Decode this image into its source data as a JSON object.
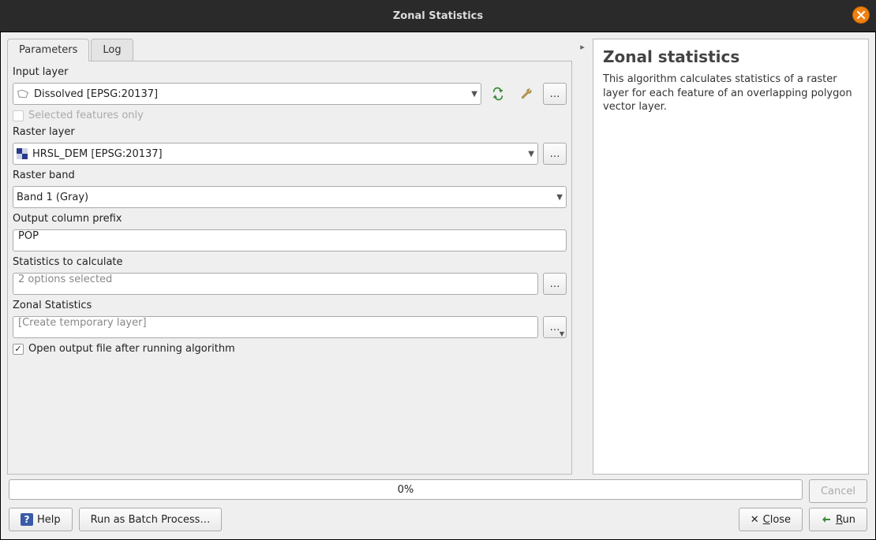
{
  "window": {
    "title": "Zonal Statistics"
  },
  "tabs": {
    "parameters": "Parameters",
    "log": "Log"
  },
  "labels": {
    "input_layer": "Input layer",
    "selected_only": "Selected features only",
    "raster_layer": "Raster layer",
    "raster_band": "Raster band",
    "output_prefix": "Output column prefix",
    "stats_to_calc": "Statistics to calculate",
    "zonal_stats": "Zonal Statistics",
    "open_output": "Open output file after running algorithm"
  },
  "values": {
    "input_layer": "Dissolved [EPSG:20137]",
    "raster_layer": "HRSL_DEM [EPSG:20137]",
    "raster_band": "Band 1 (Gray)",
    "output_prefix": "POP",
    "stats_selected": "2 options selected",
    "zonal_output": "[Create temporary layer]",
    "open_output_checked": true,
    "selected_only_checked": false,
    "selected_only_enabled": false
  },
  "side": {
    "heading": "Zonal statistics",
    "desc": "This algorithm calculates statistics of a raster layer for each feature of an overlapping polygon vector layer."
  },
  "progress": {
    "text": "0%"
  },
  "buttons": {
    "cancel": "Cancel",
    "help": "Help",
    "batch": "Run as Batch Process…",
    "close_pre": "",
    "close_u": "C",
    "close_post": "lose",
    "run_pre": "",
    "run_u": "R",
    "run_post": "un",
    "ellipsis": "…"
  },
  "icons": {
    "close_window": "close-icon",
    "iterate": "iterate-icon",
    "wrench": "wrench-icon",
    "ellipsis": "ellipsis-icon",
    "help": "help-icon",
    "x": "x-icon",
    "run_play": "run-icon"
  }
}
